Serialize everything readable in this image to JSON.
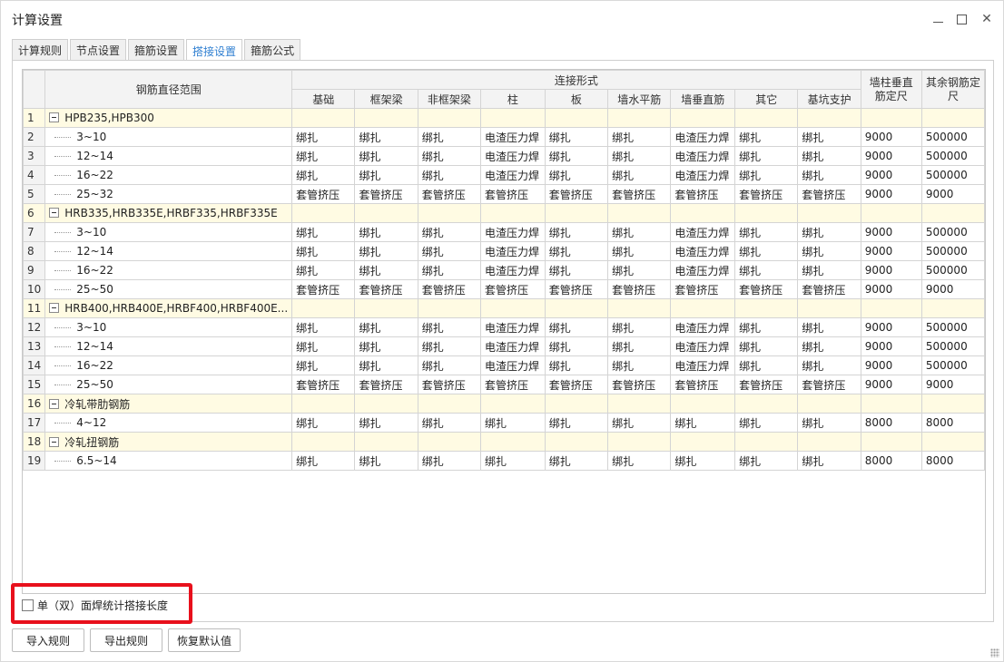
{
  "window": {
    "title": "计算设置"
  },
  "tabs": [
    {
      "label": "计算规则",
      "active": false
    },
    {
      "label": "节点设置",
      "active": false
    },
    {
      "label": "箍筋设置",
      "active": false
    },
    {
      "label": "搭接设置",
      "active": true
    },
    {
      "label": "箍筋公式",
      "active": false
    }
  ],
  "table": {
    "header": {
      "range_col": "钢筋直径范围",
      "group_label": "连接形式",
      "columns": [
        "基础",
        "框架梁",
        "非框架梁",
        "柱",
        "板",
        "墙水平筋",
        "墙垂直筋",
        "其它",
        "基坑支护"
      ],
      "wall_col": "墙柱垂直筋定尺",
      "other_col": "其余钢筋定尺"
    },
    "rows": [
      {
        "num": "1",
        "name": "HPB235,HPB300",
        "group": true,
        "cells": [
          "",
          "",
          "",
          "",
          "",
          "",
          "",
          "",
          "",
          "",
          ""
        ]
      },
      {
        "num": "2",
        "name": "3~10",
        "group": false,
        "cells": [
          "绑扎",
          "绑扎",
          "绑扎",
          "电渣压力焊",
          "绑扎",
          "绑扎",
          "电渣压力焊",
          "绑扎",
          "绑扎",
          "9000",
          "500000"
        ]
      },
      {
        "num": "3",
        "name": "12~14",
        "group": false,
        "cells": [
          "绑扎",
          "绑扎",
          "绑扎",
          "电渣压力焊",
          "绑扎",
          "绑扎",
          "电渣压力焊",
          "绑扎",
          "绑扎",
          "9000",
          "500000"
        ]
      },
      {
        "num": "4",
        "name": "16~22",
        "group": false,
        "cells": [
          "绑扎",
          "绑扎",
          "绑扎",
          "电渣压力焊",
          "绑扎",
          "绑扎",
          "电渣压力焊",
          "绑扎",
          "绑扎",
          "9000",
          "500000"
        ]
      },
      {
        "num": "5",
        "name": "25~32",
        "group": false,
        "cells": [
          "套管挤压",
          "套管挤压",
          "套管挤压",
          "套管挤压",
          "套管挤压",
          "套管挤压",
          "套管挤压",
          "套管挤压",
          "套管挤压",
          "9000",
          "9000"
        ]
      },
      {
        "num": "6",
        "name": "HRB335,HRB335E,HRBF335,HRBF335E",
        "group": true,
        "cells": [
          "",
          "",
          "",
          "",
          "",
          "",
          "",
          "",
          "",
          "",
          ""
        ]
      },
      {
        "num": "7",
        "name": "3~10",
        "group": false,
        "cells": [
          "绑扎",
          "绑扎",
          "绑扎",
          "电渣压力焊",
          "绑扎",
          "绑扎",
          "电渣压力焊",
          "绑扎",
          "绑扎",
          "9000",
          "500000"
        ]
      },
      {
        "num": "8",
        "name": "12~14",
        "group": false,
        "cells": [
          "绑扎",
          "绑扎",
          "绑扎",
          "电渣压力焊",
          "绑扎",
          "绑扎",
          "电渣压力焊",
          "绑扎",
          "绑扎",
          "9000",
          "500000"
        ]
      },
      {
        "num": "9",
        "name": "16~22",
        "group": false,
        "cells": [
          "绑扎",
          "绑扎",
          "绑扎",
          "电渣压力焊",
          "绑扎",
          "绑扎",
          "电渣压力焊",
          "绑扎",
          "绑扎",
          "9000",
          "500000"
        ]
      },
      {
        "num": "10",
        "name": "25~50",
        "group": false,
        "cells": [
          "套管挤压",
          "套管挤压",
          "套管挤压",
          "套管挤压",
          "套管挤压",
          "套管挤压",
          "套管挤压",
          "套管挤压",
          "套管挤压",
          "9000",
          "9000"
        ]
      },
      {
        "num": "11",
        "name": "HRB400,HRB400E,HRBF400,HRBF400E...",
        "group": true,
        "cells": [
          "",
          "",
          "",
          "",
          "",
          "",
          "",
          "",
          "",
          "",
          ""
        ]
      },
      {
        "num": "12",
        "name": "3~10",
        "group": false,
        "cells": [
          "绑扎",
          "绑扎",
          "绑扎",
          "电渣压力焊",
          "绑扎",
          "绑扎",
          "电渣压力焊",
          "绑扎",
          "绑扎",
          "9000",
          "500000"
        ]
      },
      {
        "num": "13",
        "name": "12~14",
        "group": false,
        "cells": [
          "绑扎",
          "绑扎",
          "绑扎",
          "电渣压力焊",
          "绑扎",
          "绑扎",
          "电渣压力焊",
          "绑扎",
          "绑扎",
          "9000",
          "500000"
        ]
      },
      {
        "num": "14",
        "name": "16~22",
        "group": false,
        "cells": [
          "绑扎",
          "绑扎",
          "绑扎",
          "电渣压力焊",
          "绑扎",
          "绑扎",
          "电渣压力焊",
          "绑扎",
          "绑扎",
          "9000",
          "500000"
        ]
      },
      {
        "num": "15",
        "name": "25~50",
        "group": false,
        "cells": [
          "套管挤压",
          "套管挤压",
          "套管挤压",
          "套管挤压",
          "套管挤压",
          "套管挤压",
          "套管挤压",
          "套管挤压",
          "套管挤压",
          "9000",
          "9000"
        ]
      },
      {
        "num": "16",
        "name": "冷轧带肋钢筋",
        "group": true,
        "cells": [
          "",
          "",
          "",
          "",
          "",
          "",
          "",
          "",
          "",
          "",
          ""
        ]
      },
      {
        "num": "17",
        "name": "4~12",
        "group": false,
        "cells": [
          "绑扎",
          "绑扎",
          "绑扎",
          "绑扎",
          "绑扎",
          "绑扎",
          "绑扎",
          "绑扎",
          "绑扎",
          "8000",
          "8000"
        ]
      },
      {
        "num": "18",
        "name": "冷轧扭钢筋",
        "group": true,
        "cells": [
          "",
          "",
          "",
          "",
          "",
          "",
          "",
          "",
          "",
          "",
          ""
        ]
      },
      {
        "num": "19",
        "name": "6.5~14",
        "group": false,
        "cells": [
          "绑扎",
          "绑扎",
          "绑扎",
          "绑扎",
          "绑扎",
          "绑扎",
          "绑扎",
          "绑扎",
          "绑扎",
          "8000",
          "8000"
        ]
      }
    ]
  },
  "options": {
    "weld_checkbox_label": "单（双）面焊统计搭接长度",
    "weld_checked": false
  },
  "buttons": {
    "import": "导入规则",
    "export": "导出规则",
    "restore": "恢复默认值"
  }
}
